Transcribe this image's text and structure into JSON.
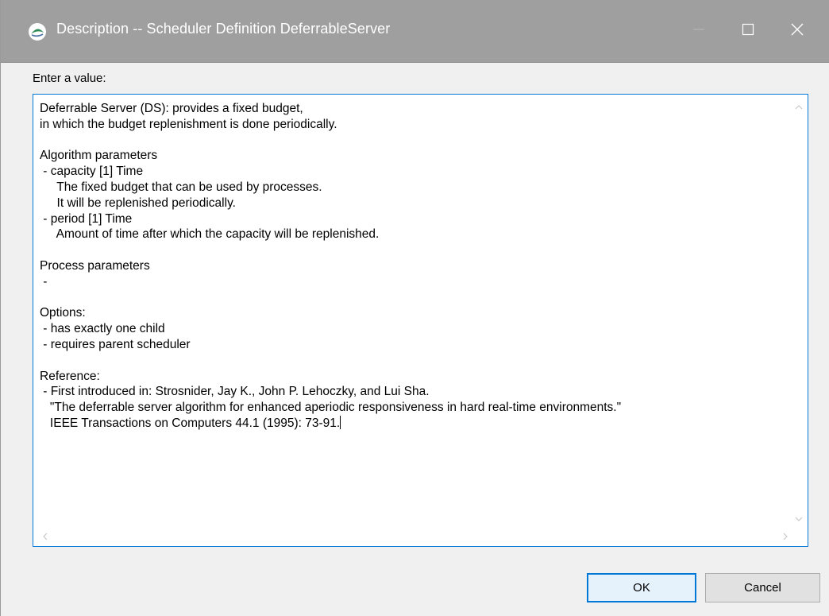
{
  "window": {
    "title": "Description -- Scheduler Definition DeferrableServer"
  },
  "prompt": "Enter a value:",
  "textarea": {
    "lines": [
      "Deferrable Server (DS): provides a fixed budget,",
      "in which the budget replenishment is done periodically.",
      "",
      "Algorithm parameters",
      " - capacity [1] Time",
      "     The fixed budget that can be used by processes.",
      "     It will be replenished periodically.",
      " - period [1] Time",
      "     Amount of time after which the capacity will be replenished.",
      "",
      "Process parameters",
      " -",
      "",
      "Options:",
      " - has exactly one child",
      " - requires parent scheduler",
      "",
      "Reference:",
      " - First introduced in: Strosnider, Jay K., John P. Lehoczky, and Lui Sha.",
      "   \"The deferrable server algorithm for enhanced aperiodic responsiveness in hard real-time environments.\"",
      "   IEEE Transactions on Computers 44.1 (1995): 73-91."
    ]
  },
  "buttons": {
    "ok_label": "OK",
    "cancel_label": "Cancel"
  },
  "colors": {
    "accent": "#0078d7",
    "titlebar": "#9f9f9f",
    "dialog_bg": "#f0f0f0"
  },
  "icons": {
    "app": "eclipse-app-icon",
    "minimize": "minimize-icon",
    "maximize": "maximize-icon",
    "close": "close-icon"
  }
}
